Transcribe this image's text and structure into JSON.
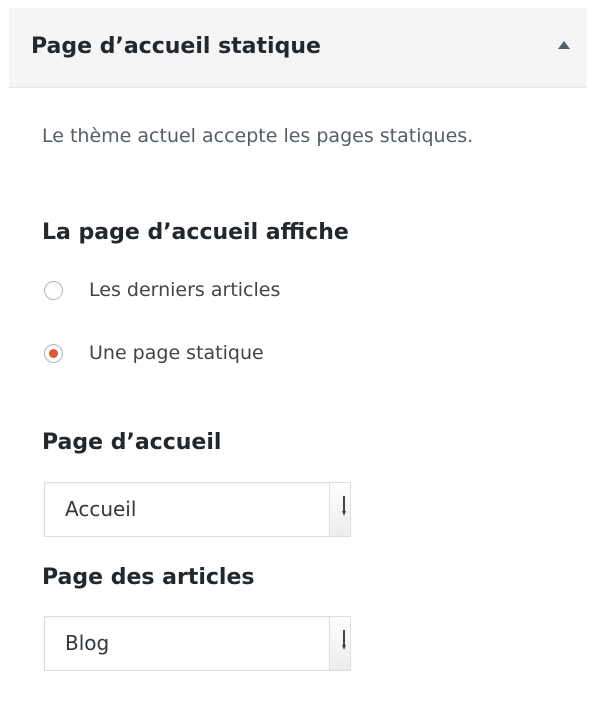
{
  "header": {
    "title": "Page d’accueil statique",
    "toggle_icon": "caret-up-icon"
  },
  "description": "Le thème actuel accepte les pages statiques.",
  "front_page_display": {
    "label": "La page d’accueil affiche",
    "options": [
      {
        "label": "Les derniers articles",
        "checked": false
      },
      {
        "label": "Une page statique",
        "checked": true
      }
    ]
  },
  "homepage_select": {
    "label": "Page d’accueil",
    "value": "Accueil"
  },
  "posts_page_select": {
    "label": "Page des articles",
    "value": "Blog"
  },
  "colors": {
    "accent": "#dd5a33",
    "header_bg": "#f5f5f5",
    "text": "#444444"
  }
}
